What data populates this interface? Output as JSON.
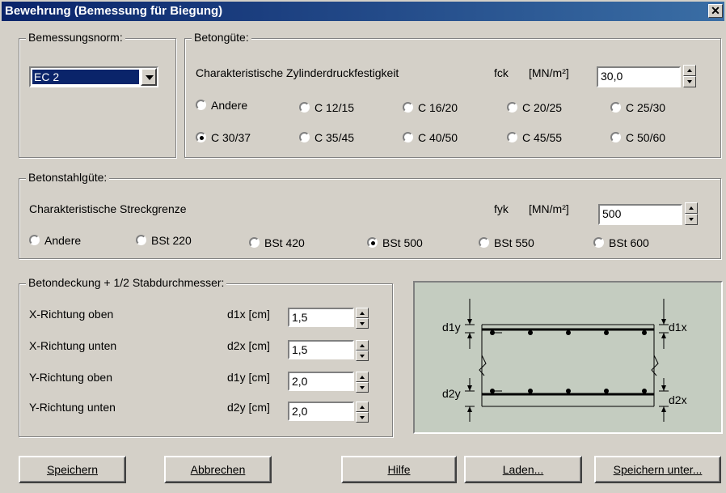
{
  "window": {
    "title": "Bewehrung (Bemessung für Biegung)"
  },
  "norm": {
    "legend": "Bemessungsnorm:",
    "selected": "EC 2"
  },
  "concrete": {
    "legend": "Betongüte:",
    "label": "Charakteristische Zylinderdruckfestigkeit",
    "symbol": "fck",
    "unit": "[MN/m²]",
    "value": "30,0",
    "options": [
      "Andere",
      "C 12/15",
      "C 16/20",
      "C 20/25",
      "C 25/30",
      "C 30/37",
      "C 35/45",
      "C 40/50",
      "C 45/55",
      "C 50/60"
    ],
    "selected": "C 30/37"
  },
  "steel": {
    "legend": "Betonstahlgüte:",
    "label": "Charakteristische Streckgrenze",
    "symbol": "fyk",
    "unit": "[MN/m²]",
    "value": "500",
    "options": [
      "Andere",
      "BSt 220",
      "BSt 420",
      "BSt 500",
      "BSt 550",
      "BSt 600"
    ],
    "selected": "BSt 500"
  },
  "cover": {
    "legend": "Betondeckung + 1/2 Stabdurchmesser:",
    "rows": [
      {
        "label": "X-Richtung oben",
        "symbol": "d1x [cm]",
        "value": "1,5"
      },
      {
        "label": "X-Richtung unten",
        "symbol": "d2x [cm]",
        "value": "1,5"
      },
      {
        "label": "Y-Richtung oben",
        "symbol": "d1y [cm]",
        "value": "2,0"
      },
      {
        "label": "Y-Richtung unten",
        "symbol": "d2y [cm]",
        "value": "2,0"
      }
    ]
  },
  "diagram": {
    "labels": {
      "d1y": "d1y",
      "d1x": "d1x",
      "d2y": "d2y",
      "d2x": "d2x"
    }
  },
  "buttons": {
    "save": "Speichern",
    "cancel": "Abbrechen",
    "help": "Hilfe",
    "load": "Laden...",
    "save_as": "Speichern unter..."
  }
}
